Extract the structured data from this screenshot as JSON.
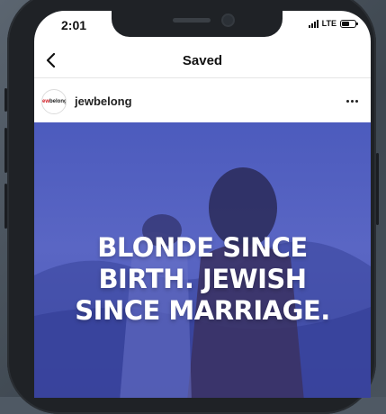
{
  "status_bar": {
    "time": "2:01",
    "network": "LTE",
    "battery_level": 0.6
  },
  "nav": {
    "title": "Saved",
    "back_icon": "chevron-left-icon"
  },
  "post": {
    "username": "jewbelong",
    "avatar_logo": {
      "part1": "jew",
      "part2": "belong",
      "accent": "#d0161e"
    },
    "more_icon": "ellipsis-icon",
    "image_text": [
      "BLONDE SINCE",
      "BIRTH. JEWISH",
      "SINCE MARRIAGE."
    ]
  },
  "colors": {
    "image_tint": "#4c5bbd",
    "phone_frame": "#1f2226"
  }
}
